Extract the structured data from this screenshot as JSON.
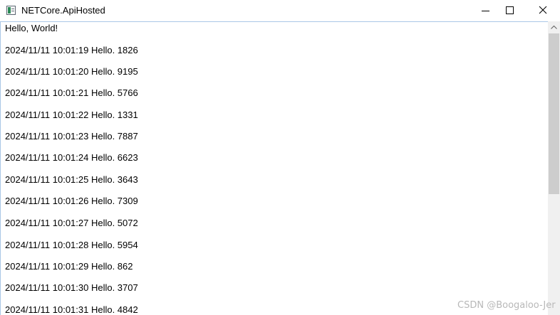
{
  "window": {
    "title": "NETCore.ApiHosted",
    "icon": "console-app-icon"
  },
  "caption_buttons": {
    "minimize": "minimize-icon",
    "maximize": "maximize-icon",
    "close": "close-icon"
  },
  "console": {
    "lines": [
      "Hello, World!",
      "2024/11/11 10:01:19 Hello. 1826",
      "2024/11/11 10:01:20 Hello. 9195",
      "2024/11/11 10:01:21 Hello. 5766",
      "2024/11/11 10:01:22 Hello. 1331",
      "2024/11/11 10:01:23 Hello. 7887",
      "2024/11/11 10:01:24 Hello. 6623",
      "2024/11/11 10:01:25 Hello. 3643",
      "2024/11/11 10:01:26 Hello. 7309",
      "2024/11/11 10:01:27 Hello. 5072",
      "2024/11/11 10:01:28 Hello. 5954",
      "2024/11/11 10:01:29 Hello. 862",
      "2024/11/11 10:01:30 Hello. 3707",
      "2024/11/11 10:01:31 Hello. 4842"
    ]
  },
  "scrollbar": {
    "up_arrow": "chevron-up-icon"
  },
  "watermark": {
    "text": "CSDN @Boogaloo-Jer"
  },
  "colors": {
    "content_border": "#a9c6e6",
    "scroll_track": "#f0f0f0",
    "scroll_thumb": "#cdcdcd",
    "watermark": "#b8b8b8"
  }
}
